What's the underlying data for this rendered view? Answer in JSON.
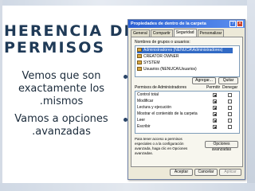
{
  "slide": {
    "title_lines": [
      "HERENCIA DE",
      "PERMISOS"
    ],
    "bullets": [
      {
        "lines": [
          "Vemos que son",
          "exactamente los",
          ".mismos"
        ]
      },
      {
        "lines": [
          "Vamos a opciones",
          ".avanzadas"
        ]
      }
    ]
  },
  "dialog": {
    "title": "Propiedades de dentro de la carpeta",
    "help_glyph": "?",
    "close_glyph": "×",
    "tabs": [
      "General",
      "Compartir",
      "Seguridad",
      "Personalizar"
    ],
    "active_tab": "Seguridad",
    "groups_label": "Nombres de grupos o usuarios:",
    "groups": [
      "Administradores (NENUCA\\Administradores)",
      "CREATOR OWNER",
      "SYSTEM",
      "Usuarios (NENUCA\\Usuarios)"
    ],
    "add_button": "Agregar...",
    "remove_button": "Quitar",
    "permissions_header": "Permisos de Administradores",
    "allow_label": "Permitir",
    "deny_label": "Denegar",
    "permissions": [
      "Control total",
      "Modificar",
      "Lectura y ejecución",
      "Mostrar el contenido de la carpeta",
      "Leer",
      "Escribir"
    ],
    "advanced_text": "Para tener acceso a permisos especiales o a la configuración avanzada, haga clic en Opciones avanzadas.",
    "advanced_button": "Opciones avanzadas",
    "ok_button": "Aceptar",
    "cancel_button": "Cancelar",
    "apply_button": "Aplicar"
  }
}
